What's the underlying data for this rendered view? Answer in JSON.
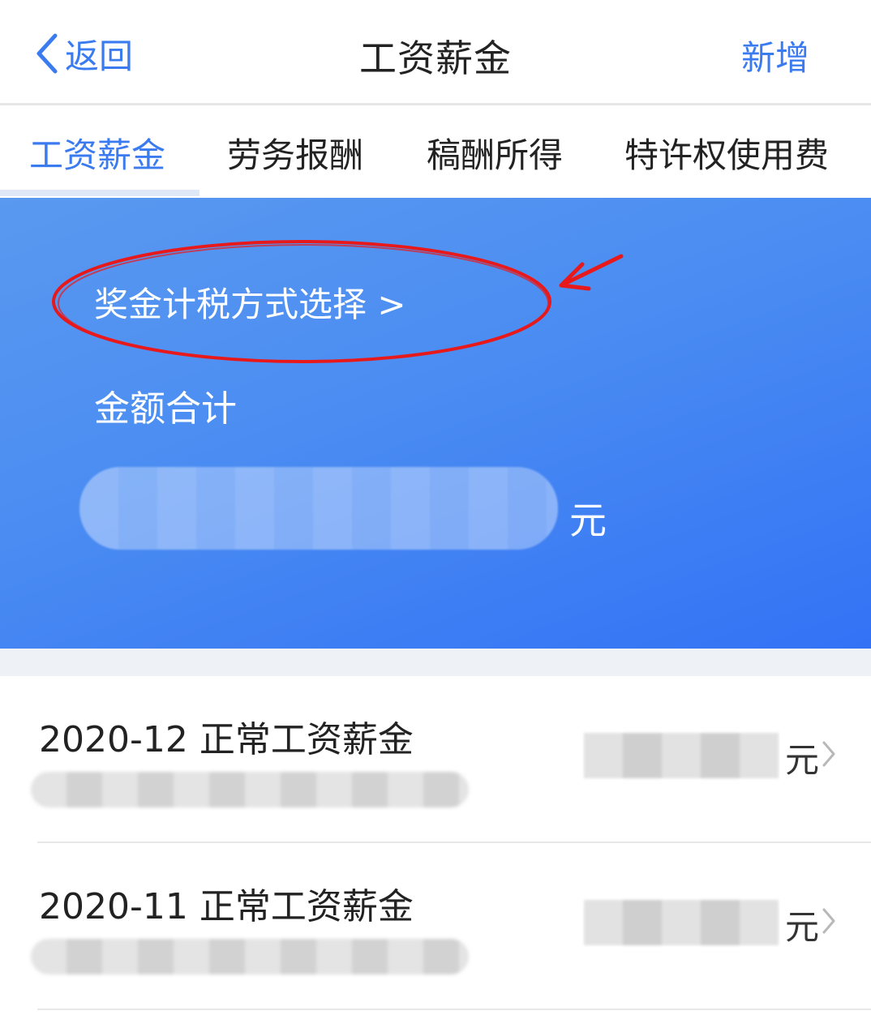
{
  "nav": {
    "back_label": "返回",
    "title": "工资薪金",
    "add_label": "新增"
  },
  "tabs": [
    {
      "label": "工资薪金",
      "active": true
    },
    {
      "label": "劳务报酬",
      "active": false
    },
    {
      "label": "稿酬所得",
      "active": false
    },
    {
      "label": "特许权使用费",
      "active": false
    }
  ],
  "summary": {
    "bonus_link": "奖金计税方式选择 >",
    "total_label": "金额合计",
    "currency": "元"
  },
  "records": [
    {
      "title": "2020-12 正常工资薪金",
      "currency": "元"
    },
    {
      "title": "2020-11 正常工资薪金",
      "currency": "元"
    }
  ],
  "colors": {
    "accent": "#3b7bf0",
    "card_gradient_start": "#5a99f0",
    "card_gradient_end": "#3372f5",
    "annotation": "#e8191b"
  },
  "icons": {
    "back": "chevron-left-icon",
    "row_chevron": "chevron-right-icon"
  }
}
